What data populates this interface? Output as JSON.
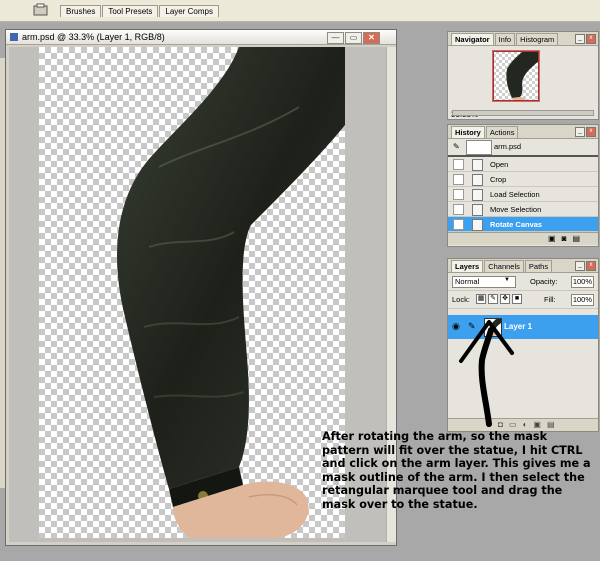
{
  "toolbar": {
    "tabs": [
      "Brushes",
      "Tool Presets",
      "Layer Comps"
    ]
  },
  "document": {
    "title": "arm.psd @ 33.3% (Layer 1, RGB/8)",
    "buttons": {
      "minimize": "—",
      "restore": "▭",
      "close": "✕"
    }
  },
  "navigator": {
    "tabs": [
      "Navigator",
      "Info",
      "Histogram"
    ],
    "zoom": "33.33%"
  },
  "history": {
    "tabs": [
      "History",
      "Actions"
    ],
    "snapshot": "arm.psd",
    "items": [
      "Open",
      "Crop",
      "Load Selection",
      "Move Selection",
      "Rotate Canvas"
    ],
    "selected_index": 4
  },
  "layers": {
    "tabs": [
      "Layers",
      "Channels",
      "Paths"
    ],
    "blend_mode": "Normal",
    "opacity_label": "Opacity:",
    "opacity": "100%",
    "lock_label": "Lock:",
    "fill_label": "Fill:",
    "fill": "100%",
    "layer_name": "Layer 1"
  },
  "annotation": {
    "text": "After rotating the arm, so the mask pattern will fit over the statue, I hit CTRL and click on the arm layer.  This gives me a mask outline of the arm.  I then select the retangular marquee tool and drag the mask over to the statue."
  },
  "colors": {
    "selection": "#3da0ee",
    "sleeve": "#1f241d",
    "skin": "#e0b79a"
  }
}
